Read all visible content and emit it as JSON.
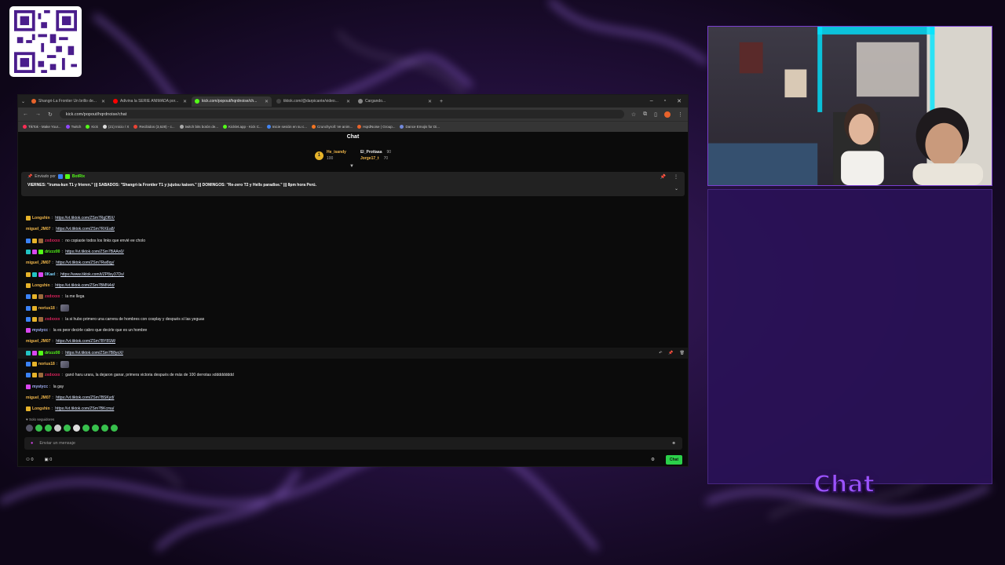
{
  "browser": {
    "tabs": [
      {
        "label": "Shangri-La Frontier Un brillo de...",
        "fav_color": "#e8632b",
        "active": false
      },
      {
        "label": "Adivina la SERIE ANIMADA por...",
        "fav_color": "#ff0000",
        "active": false
      },
      {
        "label": "kick.com/popout/hqrdnoise/ch...",
        "fav_color": "#53fc18",
        "active": true
      },
      {
        "label": "tiktok.com/@darpicante/video...",
        "fav_color": "#444444",
        "active": false
      },
      {
        "label": "Cargando...",
        "fav_color": "#888888",
        "active": false
      }
    ],
    "new_tab": "+",
    "window_controls": [
      "–",
      "▫",
      "✕"
    ],
    "url": "kick.com/popout/hqrdnoise/chat",
    "bookmarks": [
      {
        "label": "TikTok - Make Your...",
        "color": "#ff2d55"
      },
      {
        "label": "Twitch",
        "color": "#9146ff"
      },
      {
        "label": "Kick",
        "color": "#53fc18"
      },
      {
        "label": "(21) Inicio / X",
        "color": "#dddddd"
      },
      {
        "label": "Recibidos (3,628) - c...",
        "color": "#ea4335"
      },
      {
        "label": "twitch bits botón de...",
        "color": "#aaaaaa"
      },
      {
        "label": "Kicklet.app - Kick C...",
        "color": "#53fc18"
      },
      {
        "label": "Inicie sesión en su c...",
        "color": "#4285f4"
      },
      {
        "label": "Crunchyroll: Ve anim...",
        "color": "#f47521"
      },
      {
        "label": "HqrdNoise | Group...",
        "color": "#e8632b"
      },
      {
        "label": "Dance Emojis for Di...",
        "color": "#7289da"
      }
    ]
  },
  "chat": {
    "title": "Chat",
    "leaders": [
      {
        "name": "He_isandy",
        "count": "100",
        "color": "#f2b84b"
      },
      {
        "name": "El_Prottaaa",
        "count": "90",
        "color": "#ffffff"
      },
      {
        "name": "Jorge17_t",
        "count": "70",
        "color": "#f2b84b"
      }
    ],
    "pinned": {
      "by_label": "Enviado por",
      "by_user": "BotRix",
      "message": "VIERNES: \"Iruma-kun T1 y frieren.\" ||| SABADOS: \"Shangri-la Frontier T1 y jujutsu kaisen.\" ||| DOMINGOS: \"Re-zero T2 y Hells paradise.\" ||| 8pm hora Perú."
    },
    "messages": [
      {
        "user": "Longshin",
        "color": "#f2b84b",
        "text": "https://vt.tiktok.com/ZSm7RgDBX/",
        "link": true,
        "badges": [
          "#e6b32a"
        ]
      },
      {
        "user": "miguel_JM07",
        "color": "#f2b84b",
        "text": "https://vt.tiktok.com/ZSm7RXEa8/",
        "link": true,
        "badges": []
      },
      {
        "user": "zxdxxxx",
        "color": "#e0245e",
        "text": "no copiaste todos los links que envié ee cholo",
        "link": false,
        "badges": [
          "#3b82f6",
          "#e6b32a",
          "#9b6b3c"
        ]
      },
      {
        "user": "drizzz00",
        "color": "#53fc18",
        "text": "https://vt.tiktok.com/ZSm7BAAn0/",
        "link": true,
        "badges": [
          "#22c3c3",
          "#d946ef",
          "#53fc18"
        ]
      },
      {
        "user": "miguel_JM07",
        "color": "#f2b84b",
        "text": "https://vt.tiktok.com/ZSm7Rw8qy/",
        "link": true,
        "badges": []
      },
      {
        "user": "0Kael",
        "color": "#7dd3fc",
        "text": "https://www.tiktok.com/t/ZP8sy37Ds/",
        "link": true,
        "badges": [
          "#e6b32a",
          "#22c3c3",
          "#d946ef"
        ]
      },
      {
        "user": "Longshin",
        "color": "#f2b84b",
        "text": "https://vt.tiktok.com/ZSm7BMN4d/",
        "link": true,
        "badges": [
          "#e6b32a"
        ]
      },
      {
        "user": "zxdxxxx",
        "color": "#e0245e",
        "text": "la me llega",
        "link": false,
        "badges": [
          "#3b82f6",
          "#e6b32a",
          "#9b6b3c"
        ]
      },
      {
        "user": "norius18",
        "color": "#f2b84b",
        "text": "",
        "link": false,
        "emote": true,
        "badges": [
          "#3b82f6",
          "#e6b32a"
        ]
      },
      {
        "user": "zxdxxxx",
        "color": "#e0245e",
        "text": "la si hubo primero una carrera de hombres con cosplay y después sí las yeguas",
        "link": false,
        "badges": [
          "#3b82f6",
          "#e6b32a",
          "#9b6b3c"
        ]
      },
      {
        "user": "mystycc",
        "color": "#a5b4fc",
        "text": "la es peor decirle cabro que decirle que es un hombre",
        "link": false,
        "badges": [
          "#d946ef"
        ]
      },
      {
        "user": "miguel_JM07",
        "color": "#f2b84b",
        "text": "https://vt.tiktok.com/ZSm7BY8SM/",
        "link": true,
        "badges": []
      },
      {
        "user": "drizzz00",
        "color": "#53fc18",
        "text": "https://vt.tiktok.com/ZSm7B8yoX/",
        "link": true,
        "badges": [
          "#22c3c3",
          "#d946ef",
          "#53fc18"
        ],
        "hover": true
      },
      {
        "user": "norius18",
        "color": "#f2b84b",
        "text": "",
        "link": false,
        "emote": true,
        "badges": [
          "#3b82f6",
          "#e6b32a"
        ]
      },
      {
        "user": "zxdxxxx",
        "color": "#e0245e",
        "text": "ganó haru urara, la dejaron ganar, primera victoria después de más de 100 derrotas xddddddddd",
        "link": false,
        "badges": [
          "#3b82f6",
          "#e6b32a",
          "#9b6b3c"
        ]
      },
      {
        "user": "mystycc",
        "color": "#a5b4fc",
        "text": "la gay",
        "link": false,
        "badges": [
          "#d946ef"
        ]
      },
      {
        "user": "miguel_JM07",
        "color": "#f2b84b",
        "text": "https://vt.tiktok.com/ZSm7BSKyd/",
        "link": true,
        "badges": []
      },
      {
        "user": "Longshin",
        "color": "#f2b84b",
        "text": "https://vt.tiktok.com/ZSm7BKcma/",
        "link": true,
        "badges": [
          "#e6b32a"
        ]
      }
    ],
    "followers_only": "Solo seguidores",
    "input_placeholder": "Enviar un mensaje",
    "bottom_counts": [
      "0",
      "0"
    ],
    "send_label": "Chat"
  },
  "overlay": {
    "chat_label": "Chat",
    "accent": "#9b53ff"
  }
}
